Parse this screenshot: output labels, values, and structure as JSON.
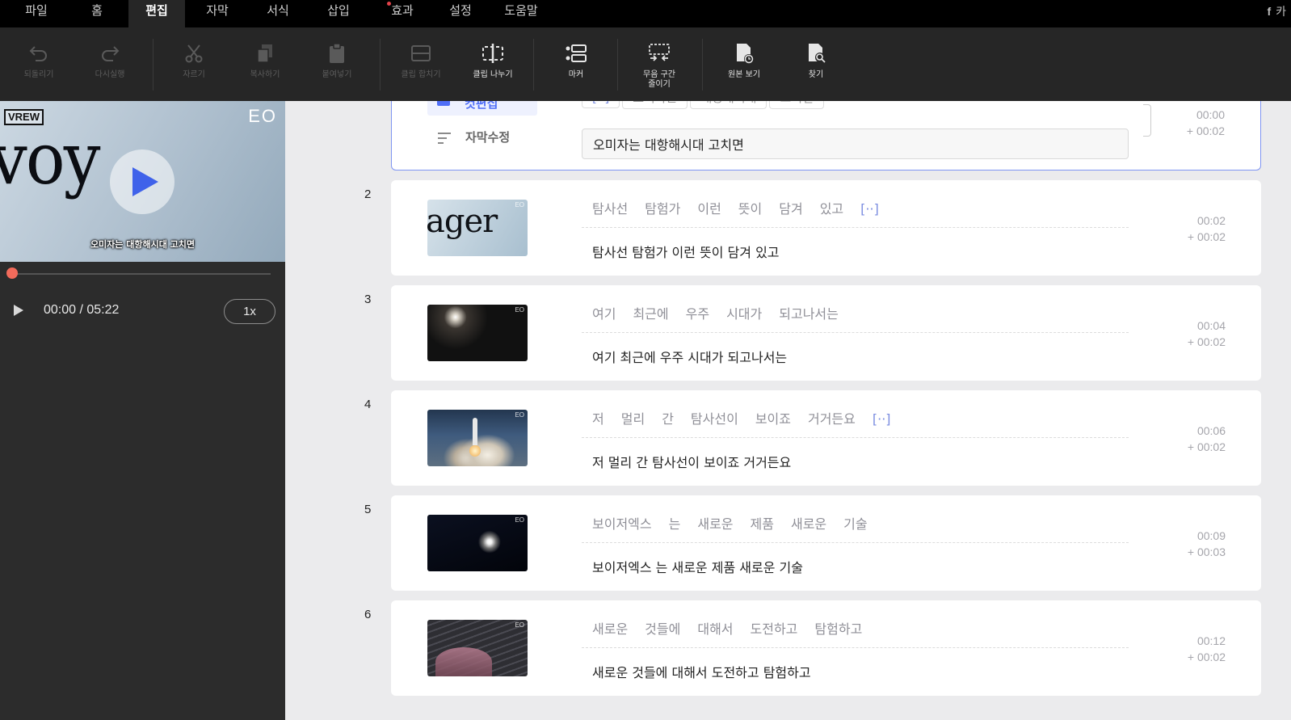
{
  "menu": {
    "tabs": [
      {
        "label": "파일"
      },
      {
        "label": "홈"
      },
      {
        "label": "편집"
      },
      {
        "label": "자막"
      },
      {
        "label": "서식"
      },
      {
        "label": "삽입"
      },
      {
        "label": "효과"
      },
      {
        "label": "설정"
      },
      {
        "label": "도움말"
      }
    ],
    "active": "편집",
    "right_label": "카"
  },
  "toolbar": {
    "undo": "되돌리기",
    "redo": "다시실행",
    "cut": "자르기",
    "copy": "복사하기",
    "paste": "붙여넣기",
    "merge": "클립 합치기",
    "split": "클립 나누기",
    "marker": "마커",
    "silence_1": "무음 구간",
    "silence_2": "줄이기",
    "original": "원본 보기",
    "find": "찾기"
  },
  "preview": {
    "logo": "VREW",
    "channel": "EO",
    "overlay_word": "voy",
    "caption": "오미자는 대항해시대 고치면",
    "time": "00:00 / 05:22",
    "speed": "1x",
    "progress_fraction": 0.0
  },
  "clip1": {
    "tag_cut": "컷편집",
    "tag_edit": "자막수정",
    "words": [
      "[··]",
      "오미자는",
      "대항해시대",
      "고치면"
    ],
    "input_value": "오미자는 대항해시대 고치면",
    "time": "00:00",
    "duration": "+ 00:02"
  },
  "clips": [
    {
      "num": "2",
      "thumb_word": "ager",
      "channel": "EO",
      "words": [
        "탐사선",
        "탐험가",
        "이런",
        "뜻이",
        "담겨",
        "있고",
        "[··]"
      ],
      "text": "탐사선 탐험가 이런 뜻이 담겨 있고",
      "time": "00:02",
      "duration": "+ 00:02"
    },
    {
      "num": "3",
      "channel": "EO",
      "words": [
        "여기",
        "최근에",
        "우주",
        "시대가",
        "되고나서는"
      ],
      "text": "여기 최근에 우주 시대가 되고나서는",
      "time": "00:04",
      "duration": "+ 00:02"
    },
    {
      "num": "4",
      "channel": "EO",
      "words": [
        "저",
        "멀리",
        "간",
        "탐사선이",
        "보이죠",
        "거거든요",
        "[··]"
      ],
      "text": "저 멀리 간 탐사선이 보이죠 거거든요",
      "time": "00:06",
      "duration": "+ 00:02"
    },
    {
      "num": "5",
      "channel": "EO",
      "words": [
        "보이저엑스",
        "는",
        "새로운",
        "제품",
        "새로운",
        "기술"
      ],
      "text": "보이저엑스 는 새로운 제품 새로운 기술",
      "time": "00:09",
      "duration": "+ 00:03"
    },
    {
      "num": "6",
      "channel": "EO",
      "words": [
        "새로운",
        "것들에",
        "대해서",
        "도전하고",
        "탐험하고"
      ],
      "text": "새로운 것들에 대해서 도전하고 탐험하고",
      "time": "00:12",
      "duration": "+ 00:02"
    }
  ],
  "colors": {
    "accent": "#4f6ef7",
    "seek": "#f26b5b",
    "gap": "#7b8de0"
  }
}
